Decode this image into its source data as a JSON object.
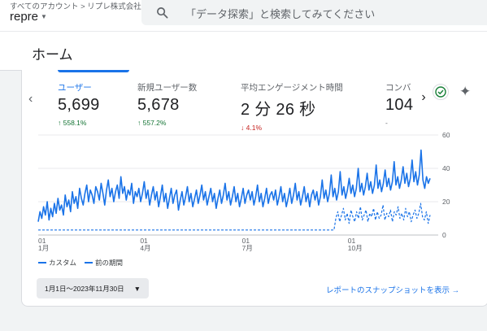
{
  "header": {
    "breadcrumb": "すべてのアカウント > リプレ株式会社",
    "property": "repre",
    "search_placeholder": "「データ探索」と検索してみてください"
  },
  "page": {
    "title": "ホーム"
  },
  "metrics": [
    {
      "label": "ユーザー",
      "value": "5,699",
      "change": "558.1%",
      "direction": "up",
      "active": true
    },
    {
      "label": "新規ユーザー数",
      "value": "5,678",
      "change": "557.2%",
      "direction": "up",
      "active": false
    },
    {
      "label": "平均エンゲージメント時間",
      "value": "2 分 26 秒",
      "change": "4.1%",
      "direction": "down",
      "active": false
    },
    {
      "label": "コンバ",
      "value": "104",
      "change": "-",
      "direction": "none",
      "active": false
    }
  ],
  "icons": {
    "left_arrow": "chevron-left-icon",
    "right_arrow": "chevron-right-icon",
    "insights_check": "check-circle-icon",
    "insights": "sparkle-icon",
    "search": "search-icon",
    "date_dropdown": "caret-down-icon",
    "snapshot": "arrow-right-icon"
  },
  "colors": {
    "accent": "#1a73e8",
    "up": "#137333",
    "down": "#c5221f",
    "check_green": "#188038"
  },
  "chart_data": {
    "type": "line",
    "x_ticks": [
      {
        "day": "01",
        "month": "1月"
      },
      {
        "day": "01",
        "month": "4月"
      },
      {
        "day": "01",
        "month": "7月"
      },
      {
        "day": "01",
        "month": "10月"
      }
    ],
    "y_ticks": [
      "60",
      "40",
      "20",
      "0"
    ],
    "ylim": [
      0,
      60
    ],
    "grid": true,
    "series": [
      {
        "name": "カスタム",
        "style": "solid",
        "values": [
          8,
          14,
          10,
          17,
          12,
          20,
          9,
          16,
          11,
          19,
          13,
          22,
          15,
          18,
          12,
          24,
          17,
          21,
          14,
          26,
          19,
          23,
          16,
          28,
          22,
          18,
          25,
          30,
          20,
          27,
          24,
          19,
          29,
          26,
          21,
          31,
          25,
          18,
          27,
          33,
          23,
          28,
          20,
          26,
          30,
          22,
          35,
          25,
          29,
          21,
          27,
          24,
          31,
          19,
          26,
          23,
          28,
          20,
          25,
          32,
          22,
          27,
          18,
          24,
          29,
          21,
          26,
          17,
          23,
          30,
          20,
          25,
          16,
          22,
          28,
          19,
          24,
          27,
          15,
          21,
          26,
          18,
          23,
          29,
          20,
          25,
          17,
          22,
          27,
          19,
          24,
          30,
          21,
          26,
          18,
          23,
          28,
          20,
          25,
          16,
          22,
          27,
          19,
          24,
          31,
          21,
          26,
          18,
          23,
          29,
          20,
          25,
          17,
          22,
          28,
          19,
          24,
          27,
          21,
          26,
          18,
          23,
          30,
          20,
          25,
          17,
          22,
          28,
          19,
          24,
          26,
          21,
          27,
          18,
          23,
          29,
          20,
          25,
          17,
          22,
          28,
          19,
          24,
          31,
          21,
          26,
          18,
          23,
          29,
          20,
          25,
          17,
          24,
          27,
          21,
          26,
          18,
          23,
          33,
          22,
          27,
          20,
          25,
          36,
          23,
          28,
          21,
          26,
          38,
          24,
          29,
          22,
          27,
          34,
          25,
          30,
          23,
          28,
          40,
          26,
          31,
          24,
          29,
          37,
          27,
          32,
          25,
          30,
          42,
          28,
          33,
          26,
          31,
          39,
          29,
          34,
          27,
          32,
          44,
          30,
          35,
          28,
          33,
          41,
          31,
          37,
          29,
          34,
          45,
          32,
          38,
          30,
          36,
          51,
          33,
          28,
          35,
          31,
          34
        ]
      },
      {
        "name": "前の期間",
        "style": "dashed",
        "values": [
          3,
          3,
          3,
          3,
          3,
          3,
          3,
          3,
          3,
          3,
          3,
          3,
          3,
          3,
          3,
          3,
          3,
          3,
          3,
          3,
          3,
          3,
          3,
          3,
          3,
          3,
          3,
          3,
          3,
          3,
          3,
          3,
          3,
          3,
          3,
          3,
          3,
          3,
          3,
          3,
          3,
          3,
          3,
          3,
          3,
          3,
          3,
          3,
          3,
          3,
          3,
          3,
          3,
          3,
          3,
          3,
          3,
          3,
          3,
          3,
          3,
          3,
          3,
          3,
          3,
          3,
          3,
          3,
          3,
          3,
          3,
          3,
          3,
          3,
          3,
          3,
          3,
          3,
          3,
          3,
          3,
          3,
          3,
          3,
          3,
          3,
          3,
          3,
          3,
          3,
          3,
          3,
          3,
          3,
          3,
          3,
          3,
          3,
          3,
          3,
          3,
          3,
          3,
          3,
          3,
          3,
          3,
          3,
          3,
          3,
          3,
          3,
          3,
          3,
          3,
          3,
          3,
          3,
          3,
          3,
          3,
          3,
          3,
          3,
          3,
          3,
          3,
          3,
          3,
          3,
          3,
          3,
          3,
          3,
          3,
          3,
          3,
          3,
          3,
          3,
          3,
          3,
          3,
          3,
          3,
          3,
          3,
          3,
          3,
          3,
          3,
          3,
          3,
          3,
          3,
          3,
          3,
          3,
          10,
          14,
          8,
          12,
          16,
          9,
          13,
          7,
          15,
          11,
          8,
          14,
          10,
          17,
          9,
          12,
          15,
          8,
          13,
          11,
          16,
          9,
          14,
          10,
          12,
          18,
          9,
          13,
          11,
          15,
          8,
          14,
          12,
          17,
          10,
          13,
          9,
          16,
          11,
          14,
          8,
          12,
          15,
          10,
          13,
          19,
          11,
          9,
          14,
          7,
          12
        ]
      }
    ],
    "legend": "bottom-left"
  },
  "footer": {
    "date_range": "1月1日～2023年11月30日",
    "snapshot_link": "レポートのスナップショットを表示"
  }
}
